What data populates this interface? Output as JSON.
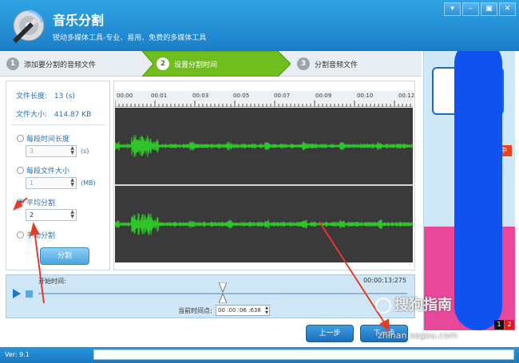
{
  "app": {
    "title": "音乐分割",
    "subtitle": "锐动多媒体工具-专业、易用、免费的多媒体工具"
  },
  "window_controls": [
    "▾",
    "–",
    "▣",
    "✕"
  ],
  "steps": [
    {
      "num": "1",
      "label": "添加要分割的音频文件",
      "active": false
    },
    {
      "num": "2",
      "label": "设置分割时间",
      "active": true
    },
    {
      "num": "3",
      "label": "分割音频文件",
      "active": false
    }
  ],
  "file_info": {
    "length_label": "文件长度:",
    "length_value": "13 (s)",
    "size_label": "文件大小:",
    "size_value": "414.87 KB"
  },
  "split_options": {
    "by_time_label": "每段时间长度",
    "by_time_value": "3",
    "by_time_unit": "(s)",
    "by_size_label": "每段文件大小",
    "by_size_value": "1",
    "by_size_unit": "(MB)",
    "average_label": "平均分割",
    "average_value": "2",
    "manual_label": "手动分割",
    "split_button": "分割"
  },
  "ruler_ticks": [
    "00:00",
    "00:01",
    "00:03",
    "00:05",
    "00:07",
    "00:09",
    "00:10",
    "00:12"
  ],
  "player": {
    "start_label": "开始时间:",
    "end_time": "00:00:13:275",
    "current_label": "当前时间点:",
    "current_value": "00 :00 :06 :638",
    "position_fraction": 0.5
  },
  "nav": {
    "prev": "上一步",
    "next": "下一步"
  },
  "watermark": {
    "text": "搜狗指南",
    "url": "zhinan.sogou.com"
  },
  "ad": {
    "pages": [
      "1",
      "2"
    ],
    "tag": "中"
  },
  "status": {
    "version": "Ver: 9.1"
  },
  "colors": {
    "accent": "#1b7ec7",
    "wave": "#2fc42a",
    "active_step": "#6fbe1e"
  }
}
